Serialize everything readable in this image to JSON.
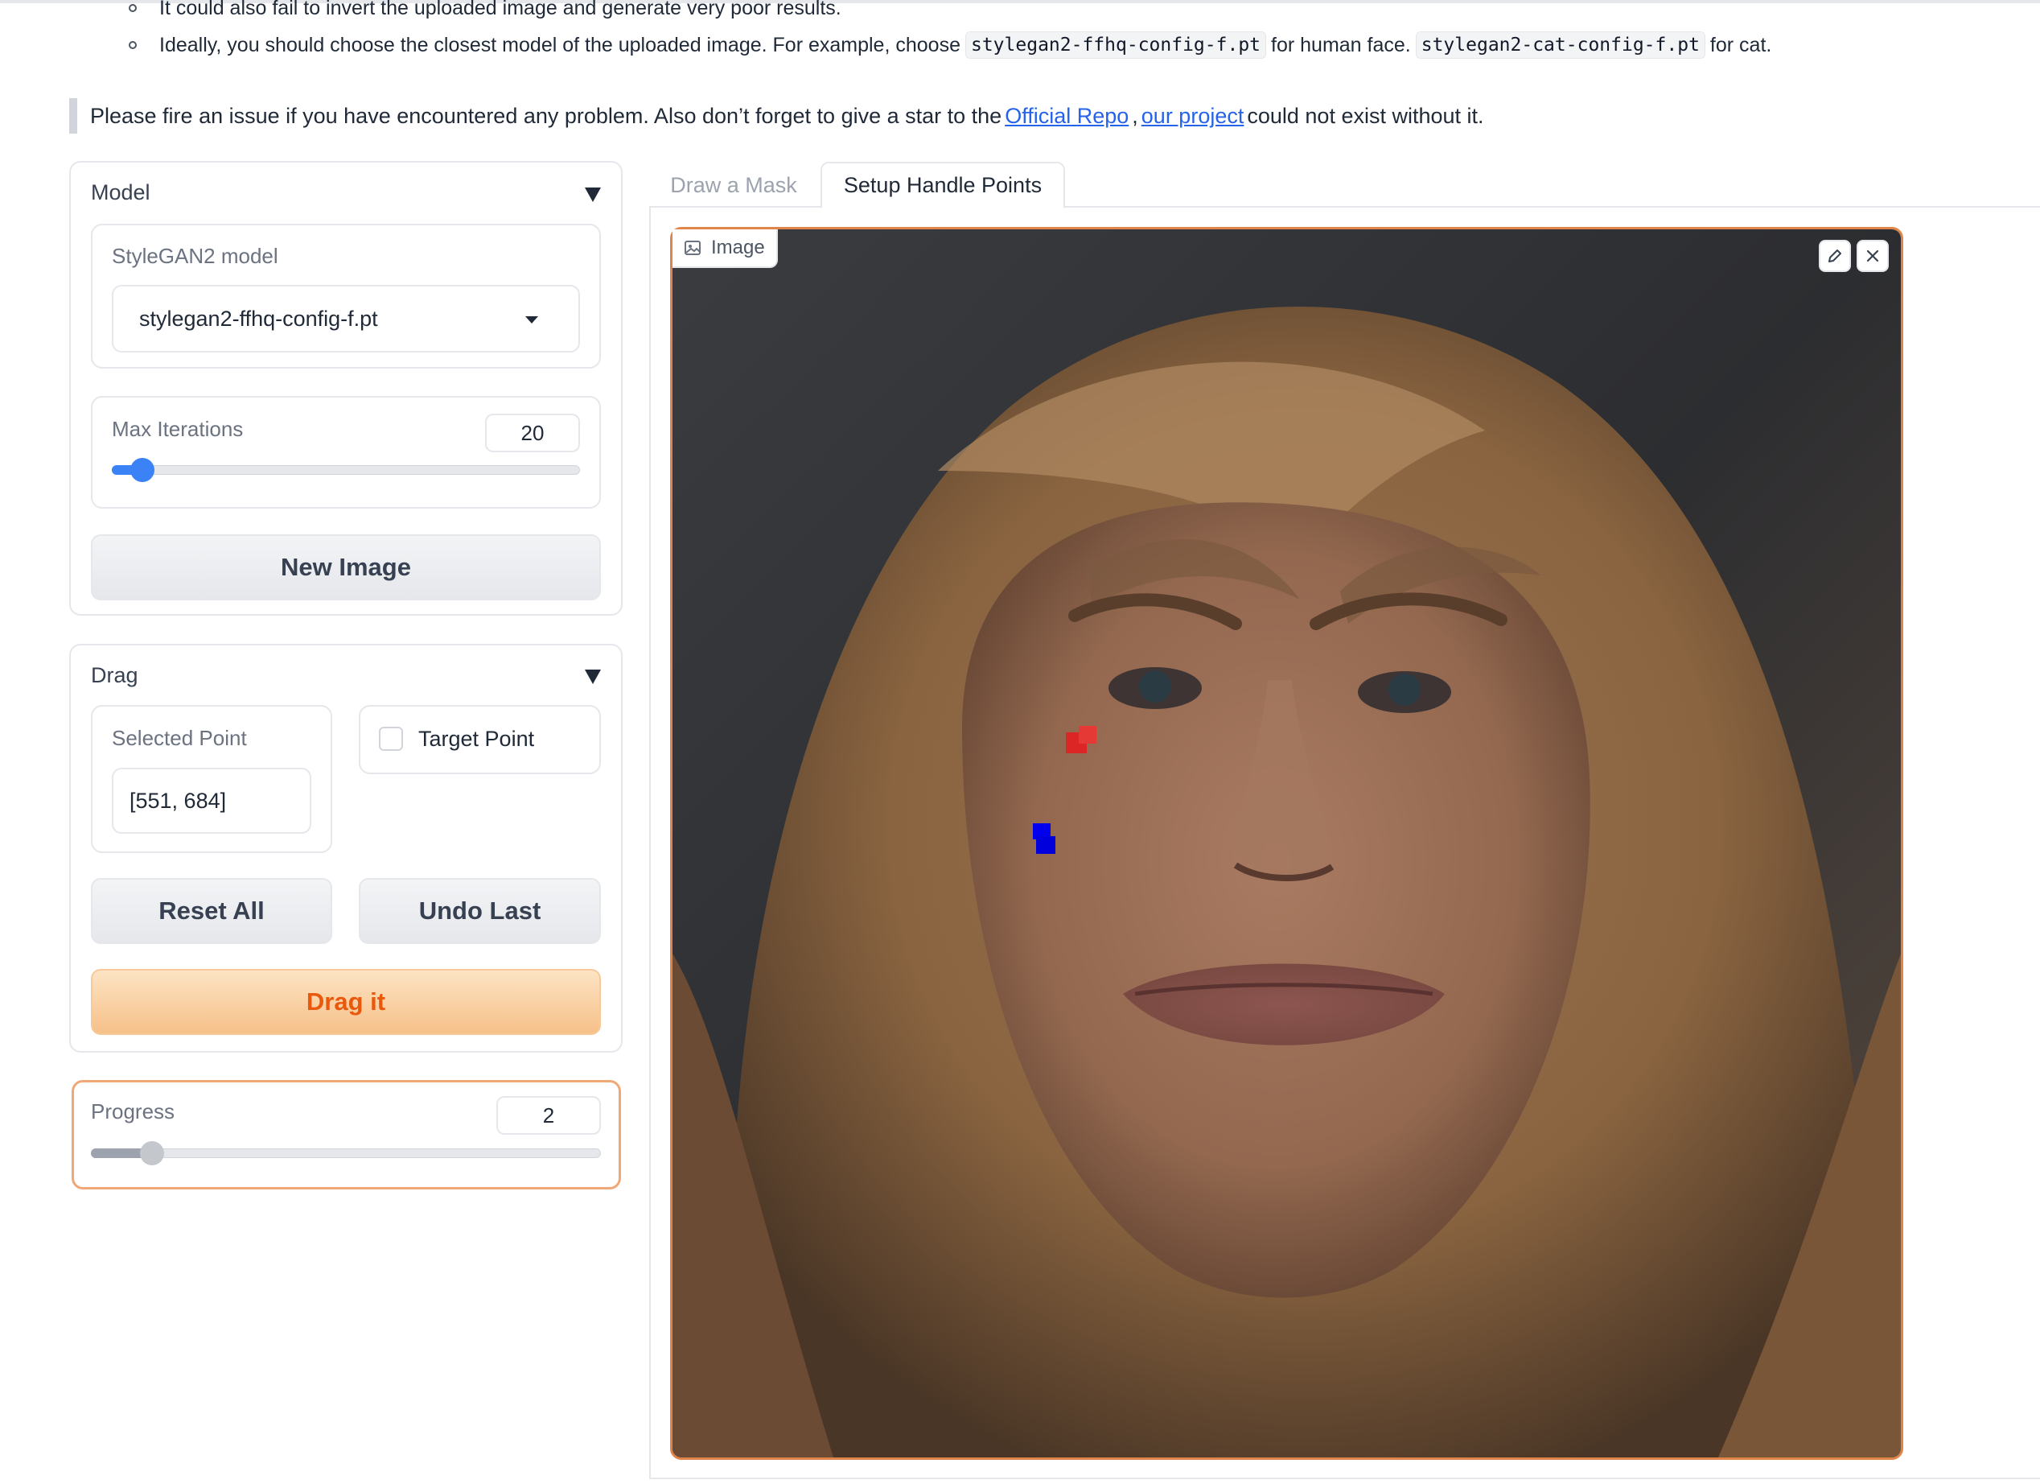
{
  "instructions": {
    "bullet1": "It could also fail to invert the uploaded image and generate very poor results.",
    "bullet2_prefix": "Ideally, you should choose the closest model of the uploaded image. For example, choose",
    "bullet2_code1": "stylegan2-ffhq-config-f.pt",
    "bullet2_mid": "for human face.",
    "bullet2_code2": "stylegan2-cat-config-f.pt",
    "bullet2_suffix": "for cat."
  },
  "notice": {
    "text_before": "Please fire an issue if you have encountered any problem. Also don’t forget to give a star to the",
    "link1": "Official Repo",
    "comma": ",",
    "link2": "our project",
    "text_after": "could not exist without it."
  },
  "model_panel": {
    "title": "Model",
    "stylegan_label": "StyleGAN2 model",
    "stylegan_value": "stylegan2-ffhq-config-f.pt",
    "max_iter_label": "Max Iterations",
    "max_iter_value": "20",
    "new_image_label": "New Image"
  },
  "drag_panel": {
    "title": "Drag",
    "selected_point_label": "Selected Point",
    "selected_point_value": "[551, 684]",
    "target_point_label": "Target Point",
    "reset_label": "Reset All",
    "undo_label": "Undo Last",
    "drag_label": "Drag it"
  },
  "progress": {
    "label": "Progress",
    "value": "2"
  },
  "tabs": [
    "Draw a Mask",
    "Setup Handle Points"
  ],
  "image_panel": {
    "label": "Image",
    "handle_points": [
      {
        "color": "#dc2626",
        "kind": "handle"
      },
      {
        "color": "#0000ee",
        "kind": "target"
      }
    ]
  },
  "colors": {
    "accent": "#f97316",
    "slider": "#3b82f6",
    "link": "#2563eb"
  },
  "icons": [
    "image-icon",
    "pencil-icon",
    "close-icon",
    "collapse-triangle-icon",
    "chevron-down-icon"
  ]
}
